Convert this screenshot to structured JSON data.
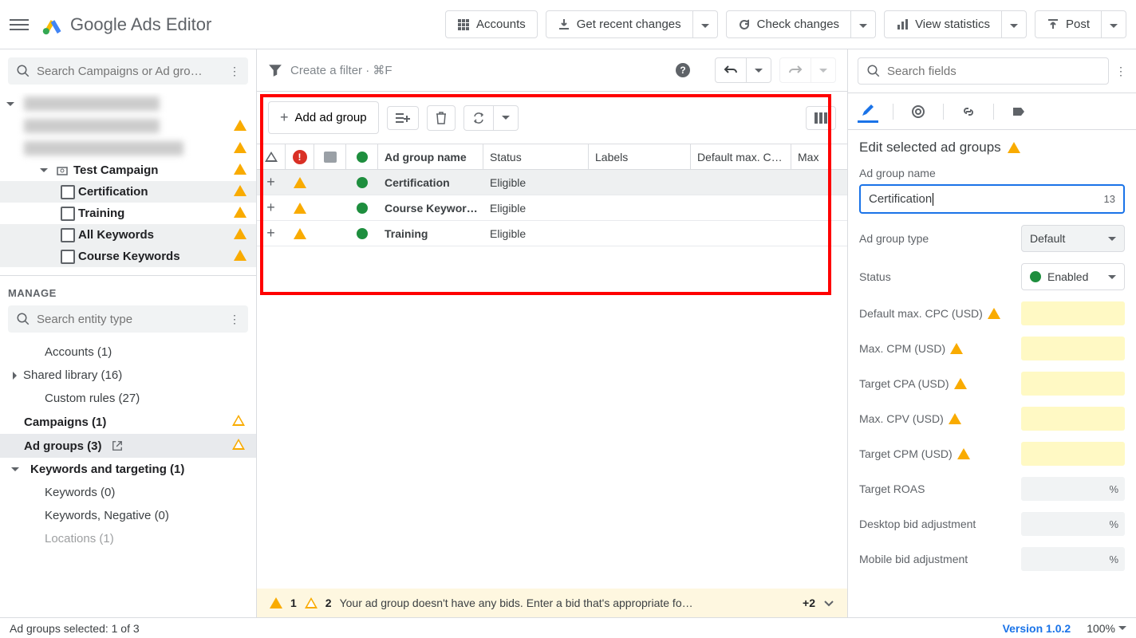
{
  "app": {
    "title": "Google Ads Editor"
  },
  "topbar": {
    "accounts": "Accounts",
    "get_recent": "Get recent changes",
    "check_changes": "Check changes",
    "view_stats": "View statistics",
    "post": "Post"
  },
  "left": {
    "search_placeholder": "Search Campaigns or Ad gro…",
    "tree": {
      "test_campaign": "Test Campaign",
      "certification": "Certification",
      "training": "Training",
      "all_keywords": "All Keywords",
      "course_keywords": "Course Keywords"
    },
    "manage_label": "MANAGE",
    "entity_search_placeholder": "Search entity type",
    "entities": {
      "accounts": "Accounts (1)",
      "shared_library": "Shared library (16)",
      "custom_rules": "Custom rules (27)",
      "campaigns": "Campaigns (1)",
      "ad_groups": "Ad groups (3)",
      "keywords_targeting": "Keywords and targeting (1)",
      "keywords": "Keywords (0)",
      "keywords_negative": "Keywords, Negative (0)",
      "locations": "Locations (1)"
    }
  },
  "mid": {
    "filter_placeholder": "Create a filter · ⌘F",
    "add_ad_group": "Add ad group",
    "columns": {
      "name": "Ad group name",
      "status": "Status",
      "labels": "Labels",
      "default_max": "Default max. C…",
      "max": "Max"
    },
    "rows": [
      {
        "name": "Certification",
        "status": "Eligible"
      },
      {
        "name": "Course Keywor…",
        "status": "Eligible"
      },
      {
        "name": "Training",
        "status": "Eligible"
      }
    ],
    "warnbar": {
      "n1": "1",
      "n2": "2",
      "msg": "Your ad group doesn't have any bids. Enter a bid that's appropriate fo…",
      "more": "+2"
    }
  },
  "right": {
    "search_placeholder": "Search fields",
    "heading": "Edit selected ad groups",
    "labels": {
      "ad_group_name": "Ad group name",
      "ad_group_type": "Ad group type",
      "status": "Status",
      "default_max_cpc": "Default max. CPC (USD)",
      "max_cpm": "Max. CPM (USD)",
      "target_cpa": "Target CPA (USD)",
      "max_cpv": "Max. CPV (USD)",
      "target_cpm": "Target CPM (USD)",
      "target_roas": "Target ROAS",
      "desktop_bid": "Desktop bid adjustment",
      "mobile_bid": "Mobile bid adjustment"
    },
    "values": {
      "name": "Certification",
      "name_counter": "13",
      "type": "Default",
      "status": "Enabled",
      "percent": "%"
    }
  },
  "status": {
    "selected": "Ad groups selected: 1 of 3",
    "version": "Version 1.0.2",
    "zoom": "100%"
  }
}
